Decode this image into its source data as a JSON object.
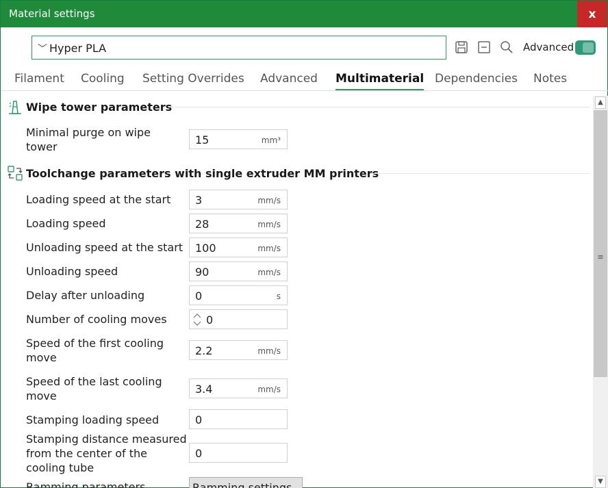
{
  "window": {
    "title": "Material settings",
    "close_label": "x"
  },
  "toolbar": {
    "preset_value": "Hyper PLA",
    "advanced_label": "Advanced",
    "advanced_on": true
  },
  "tabs": [
    {
      "label": "Filament",
      "active": false
    },
    {
      "label": "Cooling",
      "active": false
    },
    {
      "label": "Setting Overrides",
      "active": false
    },
    {
      "label": "Advanced",
      "active": false
    },
    {
      "label": "Multimaterial",
      "active": true
    },
    {
      "label": "Dependencies",
      "active": false
    },
    {
      "label": "Notes",
      "active": false
    }
  ],
  "sections": {
    "wipe_tower": {
      "title": "Wipe tower parameters",
      "rows": [
        {
          "label_line1": "Minimal purge on wipe",
          "label_line2": "tower",
          "value": "15",
          "unit": "mm³"
        }
      ]
    },
    "toolchange": {
      "title": "Toolchange parameters with single extruder MM printers",
      "rows": [
        {
          "label": "Loading speed at the start",
          "value": "3",
          "unit": "mm/s"
        },
        {
          "label": "Loading speed",
          "value": "28",
          "unit": "mm/s"
        },
        {
          "label": "Unloading speed at the start",
          "value": "100",
          "unit": "mm/s"
        },
        {
          "label": "Unloading speed",
          "value": "90",
          "unit": "mm/s"
        },
        {
          "label": "Delay after unloading",
          "value": "0",
          "unit": "s"
        },
        {
          "label": "Number of cooling moves",
          "value": "0",
          "unit": ""
        },
        {
          "label_line1": "Speed of the first cooling",
          "label_line2": "move",
          "value": "2.2",
          "unit": "mm/s"
        },
        {
          "label_line1": "Speed of the last cooling",
          "label_line2": "move",
          "value": "3.4",
          "unit": "mm/s"
        },
        {
          "label": "Stamping loading speed",
          "value": "0",
          "unit": ""
        },
        {
          "label_line1": "Stamping distance measured",
          "label_line2": "from the center of the",
          "label_line3": "cooling tube",
          "value": "0",
          "unit": ""
        },
        {
          "label": "Ramming parameters",
          "button_label": "Ramming settings"
        }
      ]
    }
  },
  "colors": {
    "accent": "#1f8a3a",
    "toggle": "#2e9a7a",
    "close": "#c62828"
  }
}
